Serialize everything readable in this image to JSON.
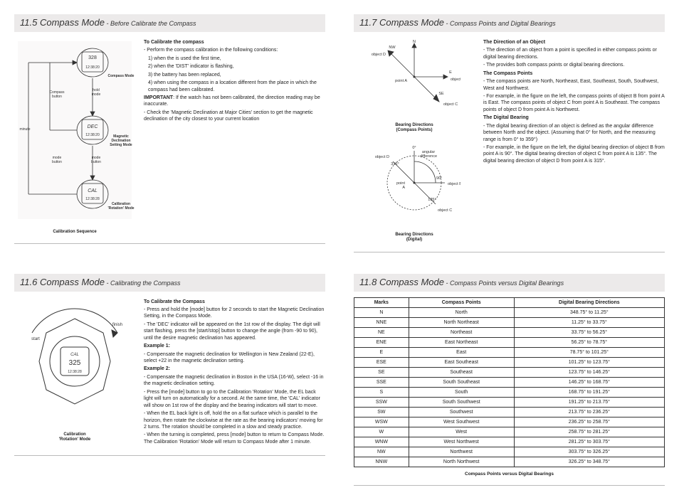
{
  "p115": {
    "title": "11.5 Compass Mode",
    "subtitle": " - Before Calibrate the Compass",
    "h1": "To Calibrate the compass",
    "t1": "- Perform the compass calibration in the following conditions:",
    "t2": "1) when the       is used the first time,",
    "t3": "2) when the 'DIST' indicator is flashing,",
    "t4": "3) the battery has been replaced,",
    "t5": "4) when using the compass in a location different from the place in which the compass had been calibrated.",
    "t6": "IMPORTANT: If the watch has not been calibrated, the direction reading may be inaccurate.",
    "t7": "- Check the 'Magnetic Declination at Major Cities' section to get the magnetic declination of the city closest to your  current  location",
    "fig": {
      "cap": "Calibration Sequence",
      "lbl_hold": "hold\nmode",
      "lbl_compass_button": "Compass\nbutton",
      "lbl_compass_mode": "Compass Mode",
      "lbl_mode_button": "mode\nbutton",
      "lbl_magnetic": "Magnetic\nDeclination\nSetting Mode",
      "lbl_minute": "minute",
      "lbl_calrot": "Calibration\n'Rotation' Mode",
      "disp1_top": "328",
      "disp1_bot": "12:38:20",
      "disp2_top": "DEC",
      "disp2_bot": "12:38:20",
      "disp3_top": "CAL",
      "disp3_bot": "12:38:28"
    }
  },
  "p116": {
    "title": "11.6 Compass Mode",
    "subtitle": " - Calibrating the Compass",
    "h1": "To Calibrate the Compass",
    "t1": "- Press and hold the [mode] button for 2 seconds to start the Magnetic Declination Setting, in the Compass Mode.",
    "t2": "- The 'DEC' indicator will be appeared on the 1st row of the display. The digit will start flashing, press the [start/stop] button to change the angle (from -90 to 90), until the desire magnetic declination has appeared.",
    "h2": "Example 1:",
    "t3": "- Compensate the magnetic declination for Wellington in New Zealand (22-E), select +22 in the magnetic declination setting.",
    "h3": "Example 2:",
    "t4": "- Compensate the magnetic declination in Boston in the USA (16-W), select -16 in the magnetic declination setting.",
    "t5": "- Press the [mode] button to go to the Calibration 'Rotation' Mode, the EL back light will turn on automatically for a second. At the same time, the 'CAL' indicator will show on 1st row of the display and the bearing indicators will start to move.",
    "t6": "- When the EL back light is off, hold the         on a flat surface which is  parallel to the horizon, then rotate the        clockwise at the rate as the bearing indicators' moving for 2 turns. The rotation should be completed in a   slow and steady practice.",
    "t7": "- When the turning is completed, press [mode] button to return to Compass Mode. The Calibration 'Rotation' Mode will return to Compass Mode after 1 minute.",
    "fig": {
      "cap": "Calibration\n'Rotation' Mode",
      "watch_top": "CAL",
      "watch_mid": "325",
      "watch_bot": "12:38:28",
      "lbl_start": "start",
      "lbl_finish": "finish"
    }
  },
  "p117": {
    "title": "11.7 Compass Mode",
    "subtitle": " - Compass Points and Digital Bearings",
    "h1": "The Direction of an Object",
    "t1": "- The direction of an object from a point is specified in either compass points or digital bearing directions.",
    "t2": "- The          provides both compass points or digital bearing directions.",
    "h2": "The Compass Points",
    "t3": "- The compass points are North, Northeast, East, Southeast, South, Southwest, West and Northwest.",
    "t4": "- For example, in the figure on the left, the compass points of object B from point A is East. The compass points of object C from point A is Southeast. The compass   points of object D from point A is Northwest.",
    "h3": "The Digital Bearing",
    "t5": "- The digital bearing direction of an object is defined as the angular difference between North and the object. (Assuming that 0° for North, and the measuring range is from 0° to 359°)",
    "t6": "- For example, in the figure on the left, the digital bearing direction of object B from point A is 90°. The digital bearing direction of object C from point A is 135°. The digital bearing direction of object D from point A is 315°.",
    "fig1": {
      "cap": "Bearing Directions\n(Compass Points)",
      "N": "N",
      "NW": "NW",
      "E": "E",
      "SE": "SE",
      "objD": "object D",
      "pointA": "point A",
      "objB": "object B",
      "objC": "object C"
    },
    "fig2": {
      "cap": "Bearing Directions\n(Digital)",
      "ang": "angular\ndifference",
      "d0": "0°",
      "d90": "90°",
      "d135": "135°",
      "d315": "315°",
      "objD": "object D",
      "pointA": "point\nA",
      "objB": "object B",
      "objC": "object C"
    }
  },
  "p118": {
    "title": "11.8 Compass Mode",
    "subtitle": " - Compass Points versus Digital Bearings",
    "caption": "Compass Points versus Digital Bearings",
    "headers": [
      "Marks",
      "Compass Points",
      "Digital Bearing Directions"
    ],
    "rows": [
      [
        "N",
        "North",
        "348.75° to 11.25°"
      ],
      [
        "NNE",
        "North Northeast",
        "11.25° to 33.75°"
      ],
      [
        "NE",
        "Northeast",
        "33.75° to 56.25°"
      ],
      [
        "ENE",
        "East Northeast",
        "56.25° to 78.75°"
      ],
      [
        "E",
        "East",
        "78.75° to 101.25°"
      ],
      [
        "ESE",
        "East Southeast",
        "101.25° to 123.75°"
      ],
      [
        "SE",
        "Southeast",
        "123.75° to 146.25°"
      ],
      [
        "SSE",
        "South Southeast",
        "146.25° to 168.75°"
      ],
      [
        "S",
        "South",
        "168.75° to 191.25°"
      ],
      [
        "SSW",
        "South Southwest",
        "191.25° to 213.75°"
      ],
      [
        "SW",
        "Southwest",
        "213.75° to 236.25°"
      ],
      [
        "WSW",
        "West Southwest",
        "236.25° to 258.75°"
      ],
      [
        "W",
        "West",
        "258.75° to 281.25°"
      ],
      [
        "WNW",
        "West Northwest",
        "281.25° to 303.75°"
      ],
      [
        "NW",
        "Northwest",
        "303.75° to 326.25°"
      ],
      [
        "NNW",
        "North Northwest",
        "326.25° to 348.75°"
      ]
    ]
  }
}
